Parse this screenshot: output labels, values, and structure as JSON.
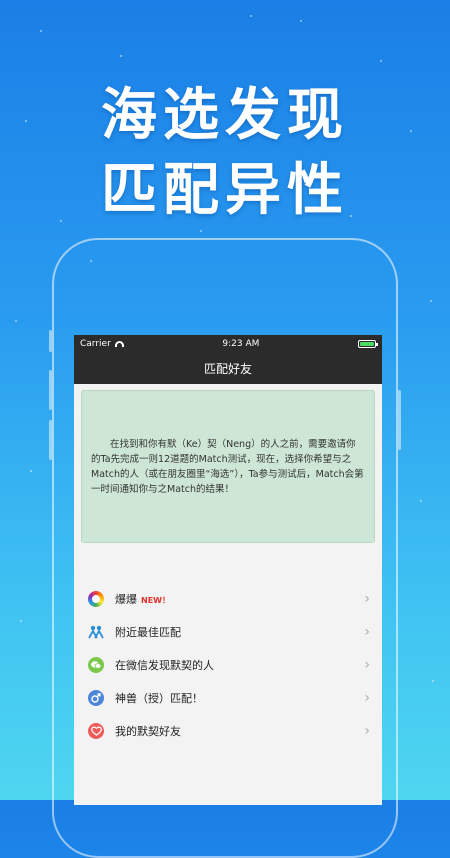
{
  "headline": {
    "line1": "海选发现",
    "line2": "匹配异性"
  },
  "status_bar": {
    "carrier": "Carrier",
    "time": "9:23 AM",
    "battery_level": 1.0
  },
  "nav": {
    "title": "匹配好友"
  },
  "notice": {
    "text": "在找到和你有默（Ke）契（Neng）的人之前，需要邀请你的Ta先完成一则12道题的Match测试，现在，选择你希望与之Match的人（或在朋友圈里“海选”），Ta参与测试后，Match会第一时间通知你与之Match的结果！"
  },
  "menu": [
    {
      "label": "爆爆",
      "badge": "NEW！",
      "icon": "color-ring-icon"
    },
    {
      "label": "附近最佳匹配",
      "badge": "",
      "icon": "people-icon"
    },
    {
      "label": "在微信发现默契的人",
      "badge": "",
      "icon": "wechat-icon"
    },
    {
      "label": "神兽（授）匹配！",
      "badge": "",
      "icon": "male-symbol-icon"
    },
    {
      "label": "我的默契好友",
      "badge": "",
      "icon": "heart-icon"
    }
  ],
  "colors": {
    "navbar": "#2b2b2b",
    "notice_bg": "#cde6d5",
    "people_icon": "#2a8fd6",
    "wechat_icon": "#7cc84a",
    "male_icon_bg": "#4d86d9",
    "heart_icon_bg": "#ee5b5b",
    "badge_new": "#e0302a"
  }
}
